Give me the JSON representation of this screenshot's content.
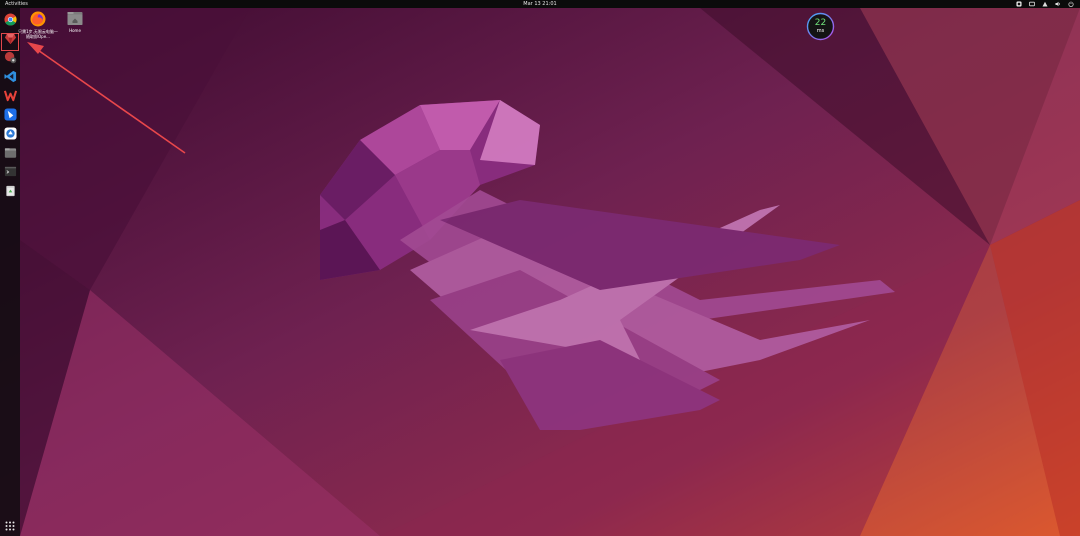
{
  "topbar": {
    "activities_label": "Activities",
    "clock": "Mar 13 21:01",
    "tray_icons": [
      "app-indicator-icon",
      "keyboard-icon",
      "network-icon",
      "volume-icon",
      "power-icon"
    ]
  },
  "dock": {
    "items": [
      {
        "name": "chrome-icon"
      },
      {
        "name": "ruby-app-icon",
        "highlighted": true
      },
      {
        "name": "software-updater-icon"
      },
      {
        "name": "vscode-icon"
      },
      {
        "name": "wps-office-icon"
      },
      {
        "name": "feishu-icon"
      },
      {
        "name": "blue-app-icon"
      },
      {
        "name": "files-icon"
      },
      {
        "name": "terminal-icon"
      },
      {
        "name": "trash-icon"
      }
    ],
    "show_apps_icon": "grid-icon"
  },
  "desktop": {
    "icons": [
      {
        "name": "firefox-icon",
        "label": "只需1步,无限云电脑—随取即Ope..."
      },
      {
        "name": "home-folder-icon",
        "label": "Home"
      }
    ]
  },
  "ping_widget": {
    "value": "22",
    "unit": "ms",
    "accent_color": "#6fe07a"
  },
  "colors": {
    "annotation_red": "#e8474b",
    "wallpaper_base": "#5c1a47",
    "wallpaper_accent": "#e0582f"
  }
}
